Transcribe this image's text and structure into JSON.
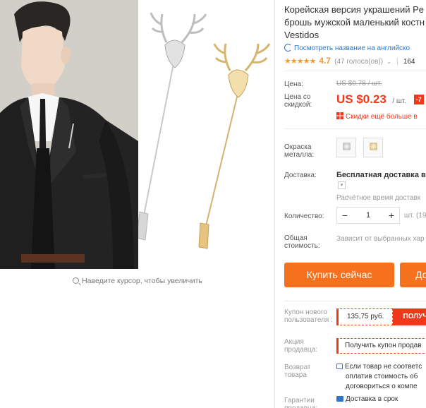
{
  "gallery": {
    "hover_hint": "Наведите курсор, чтобы увеличить"
  },
  "product": {
    "title_lines": [
      "Корейская версия украшений Pe",
      "брошь мужской маленький костн",
      "Vestidos"
    ],
    "translate_link": "Посмотреть название на английско",
    "stars": "★★★★★",
    "rating": "4.7",
    "votes": "(47 голоса(ов))",
    "orders": "164"
  },
  "price": {
    "label": "Цена:",
    "old": "US $0.78 / шт.",
    "new_label": "Цена со скидкой:",
    "new": "US $0.23",
    "unit": "/ шт.",
    "discount": "-7",
    "promo": "Скидки ещё больше в"
  },
  "options": {
    "color_label": "Окраска металла:",
    "swatches": [
      "silver",
      "gold"
    ]
  },
  "shipping": {
    "label": "Доставка:",
    "title": "Бесплатная доставка в Р",
    "time": "Расчётное время доставк"
  },
  "quantity": {
    "label": "Количество:",
    "minus": "−",
    "value": "1",
    "plus": "+",
    "unit_text": "шт. (19"
  },
  "total": {
    "label": "Общая стоимость:",
    "text": "Зависит от выбранных хар"
  },
  "actions": {
    "buy_now": "Купить сейчас",
    "cart": "До"
  },
  "coupons": {
    "new_user_label": "Купон нового пользователя :",
    "new_user_amount": "135,75 руб.",
    "new_user_get": "ПОЛУЧ",
    "seller_label": "Акция продавца:",
    "seller_text": "Получить купон продав"
  },
  "returns": {
    "label": "Возврат товара",
    "lines": [
      "Если товар не соответс",
      "оплатив стоимость об",
      "договориться о компе"
    ]
  },
  "guarantee": {
    "label": "Гарантии продавца:",
    "text": "Доставка в срок"
  },
  "colors": {
    "accent": "#f5711d",
    "price_red": "#f2371b",
    "link_blue": "#2e78c7",
    "star_orange": "#f29a2e"
  }
}
